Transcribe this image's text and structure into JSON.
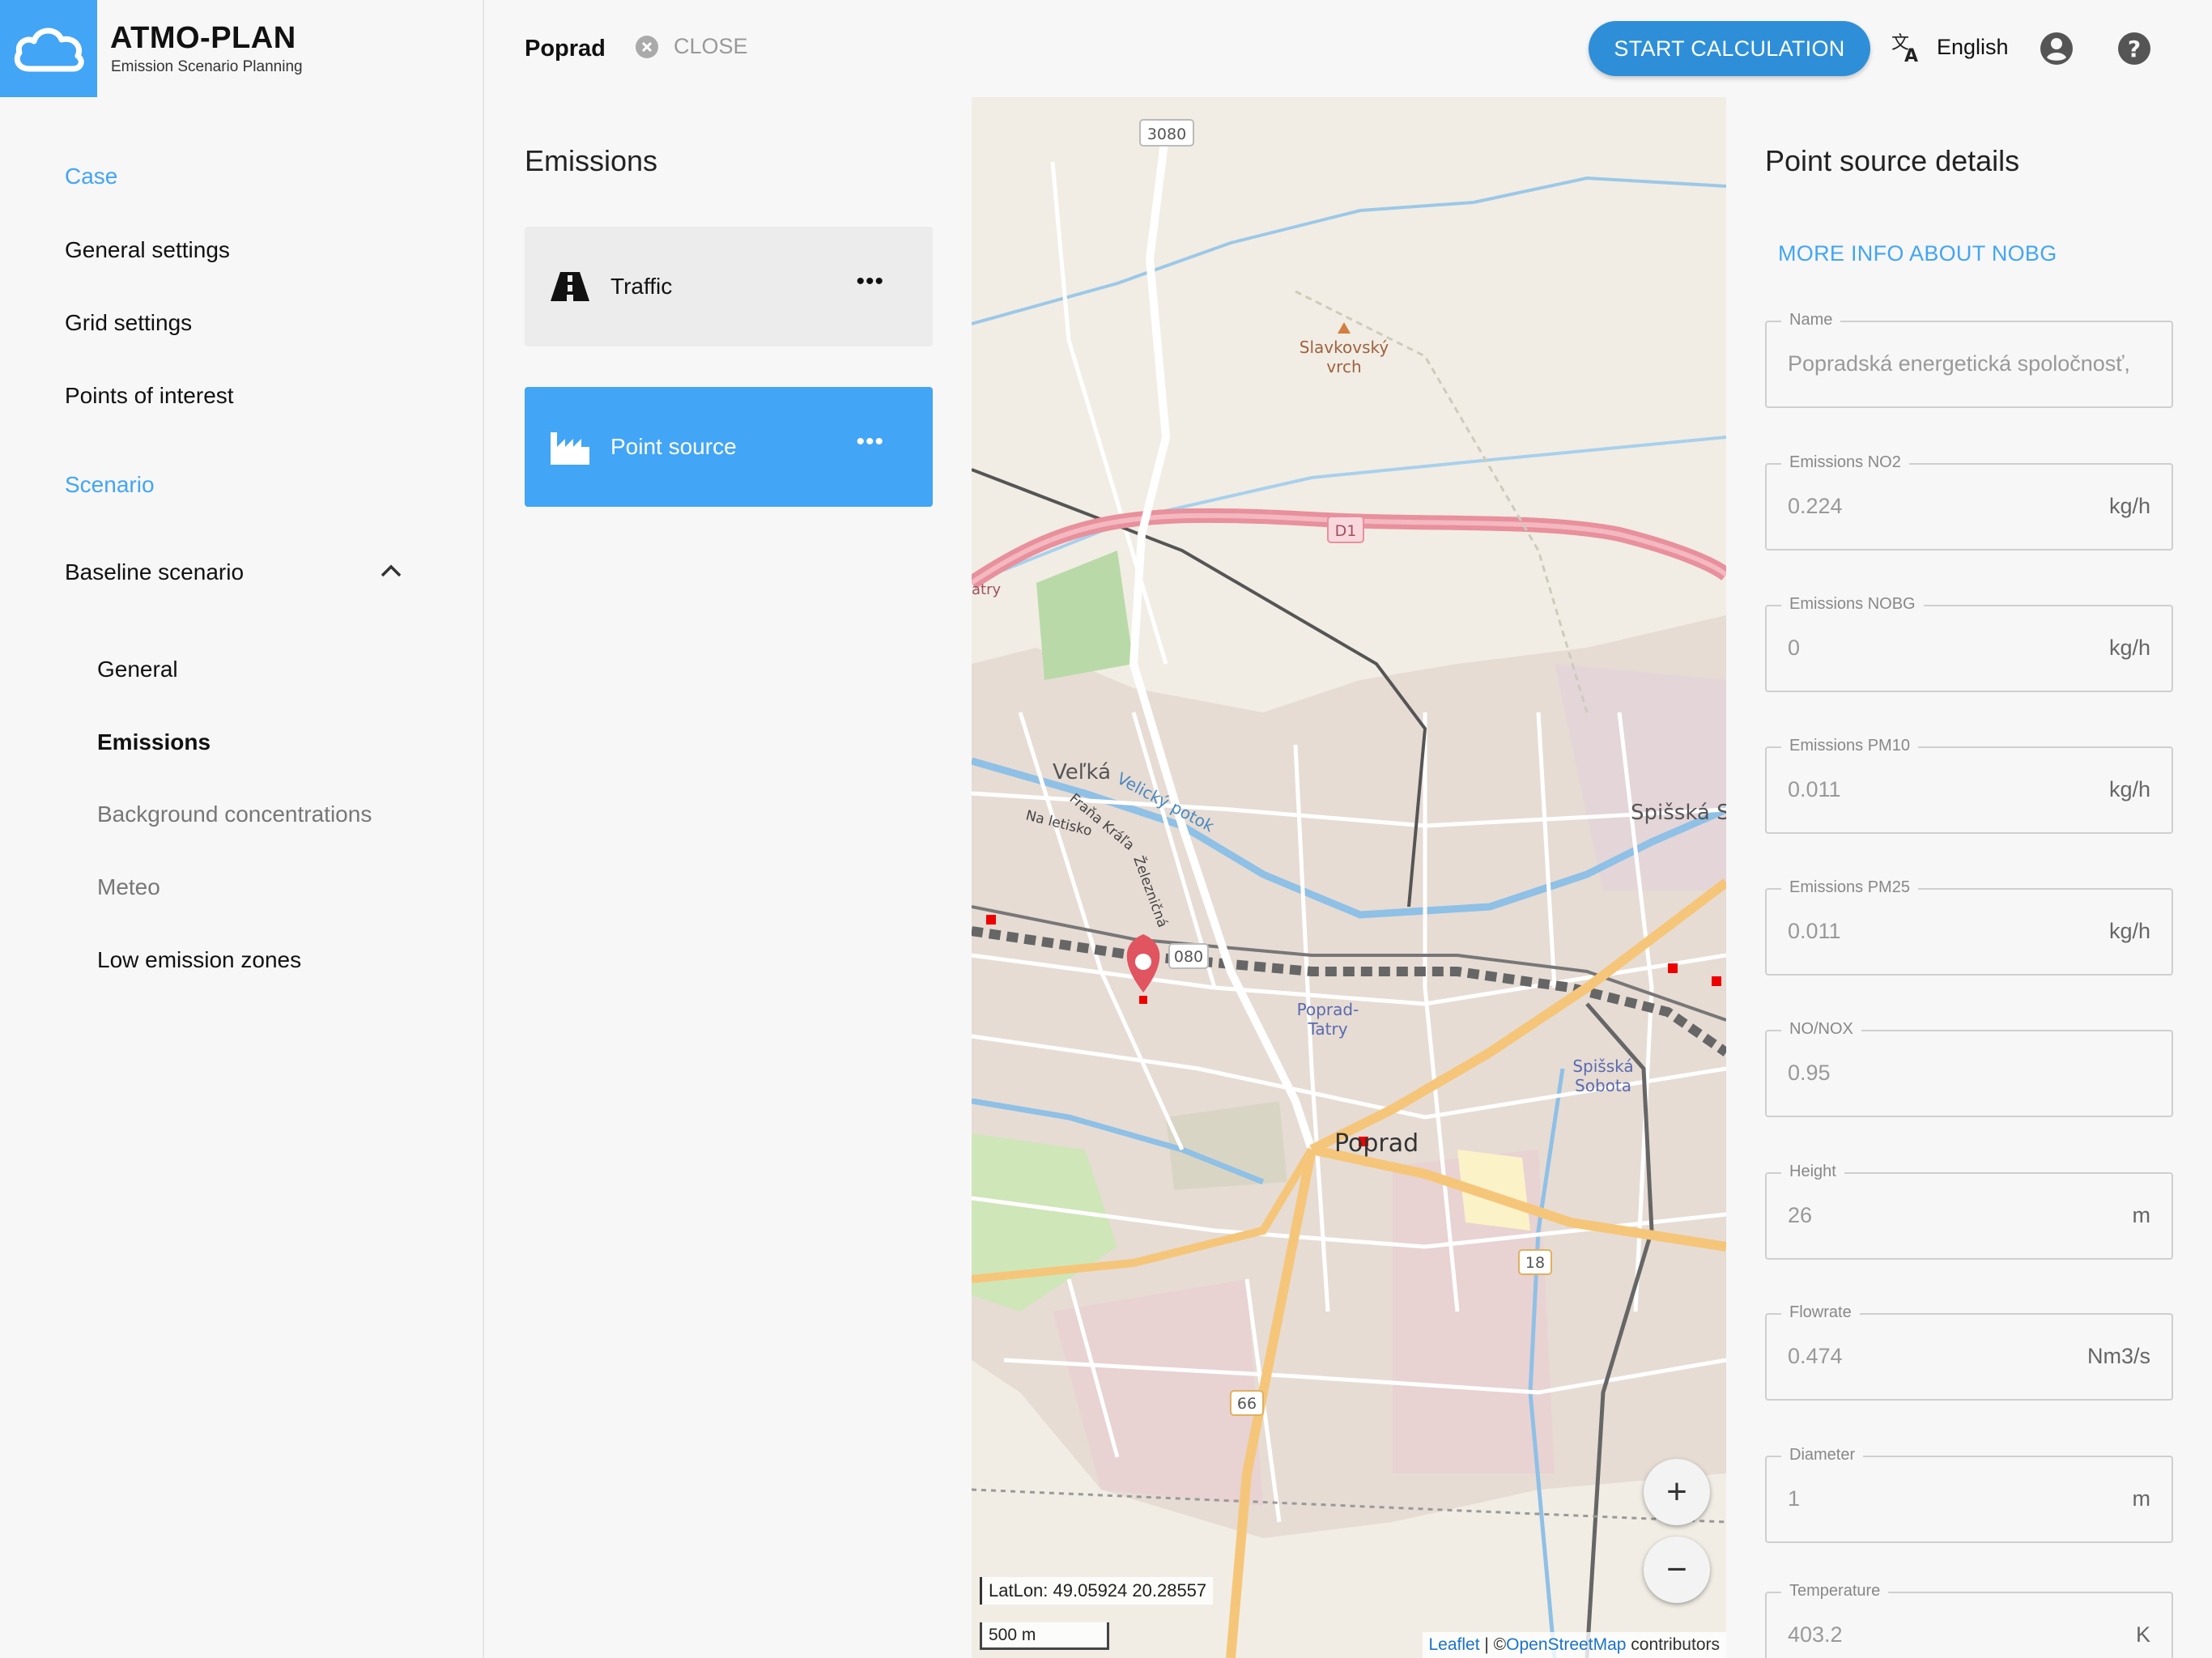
{
  "brand": {
    "title": "ATMO-PLAN",
    "subtitle": "Emission Scenario Planning",
    "logo_icon": "cloud-icon"
  },
  "sidebar": {
    "section_case": "Case",
    "general_settings": "General settings",
    "grid_settings": "Grid settings",
    "points_of_interest": "Points of interest",
    "section_scenario": "Scenario",
    "baseline_scenario": "Baseline scenario",
    "sub_items": {
      "general": "General",
      "emissions": "Emissions",
      "background": "Background concentrations",
      "meteo": "Meteo",
      "lez": "Low emission zones"
    }
  },
  "topbar": {
    "case_name": "Poprad",
    "close_label": "CLOSE",
    "start_label": "START CALCULATION",
    "language": "English"
  },
  "emissions": {
    "heading": "Emissions",
    "cards": [
      {
        "label": "Traffic",
        "icon": "road-icon"
      },
      {
        "label": "Point source",
        "icon": "factory-icon"
      }
    ],
    "menu_glyph": "•••"
  },
  "map": {
    "latlon": "LatLon: 49.05924 20.28557",
    "scale": "500 m",
    "attribution_leaflet": "Leaflet",
    "attribution_sep": " | ©",
    "attribution_osm": "OpenStreetMap",
    "attribution_tail": " contributors",
    "labels": {
      "road_3080": "3080",
      "road_d1": "D1",
      "road_080": "080",
      "road_18": "18",
      "road_66": "66",
      "slavkovsky": "Slavkovský",
      "vrch": "vrch",
      "velka": "Veľká",
      "velicky_potok": "Velický potok",
      "frana_krala": "Fraňa Kráľa",
      "na_letisko": "Na letisko",
      "zeleznicna": "Železničná",
      "spisska": "Spišská S",
      "poprad_tatry_1": "Poprad-",
      "poprad_tatry_2": "Tatry",
      "spisska_sobota_1": "Spišská",
      "spisska_sobota_2": "Sobota",
      "poprad": "Poprad",
      "tatry_edge": "atry"
    },
    "zoom_in": "+",
    "zoom_out": "−"
  },
  "details": {
    "heading": "Point source details",
    "more_info": "MORE INFO ABOUT NOBG",
    "fields": [
      {
        "label": "Name",
        "value": "Popradská energetická spoločnosť,",
        "unit": ""
      },
      {
        "label": "Emissions NO2",
        "value": "0.224",
        "unit": "kg/h"
      },
      {
        "label": "Emissions NOBG",
        "value": "0",
        "unit": "kg/h"
      },
      {
        "label": "Emissions PM10",
        "value": "0.011",
        "unit": "kg/h"
      },
      {
        "label": "Emissions PM25",
        "value": "0.011",
        "unit": "kg/h"
      },
      {
        "label": "NO/NOX",
        "value": "0.95",
        "unit": ""
      },
      {
        "label": "Height",
        "value": "26",
        "unit": "m"
      },
      {
        "label": "Flowrate",
        "value": "0.474",
        "unit": "Nm3/s"
      },
      {
        "label": "Diameter",
        "value": "1",
        "unit": "m"
      },
      {
        "label": "Temperature",
        "value": "403.2",
        "unit": "K"
      }
    ]
  },
  "colors": {
    "accent": "#42a5f5",
    "start_button": "#2e8fd8",
    "marker": "#e05560",
    "motorway": "#e8909c",
    "primary_road": "#f5c67a"
  }
}
